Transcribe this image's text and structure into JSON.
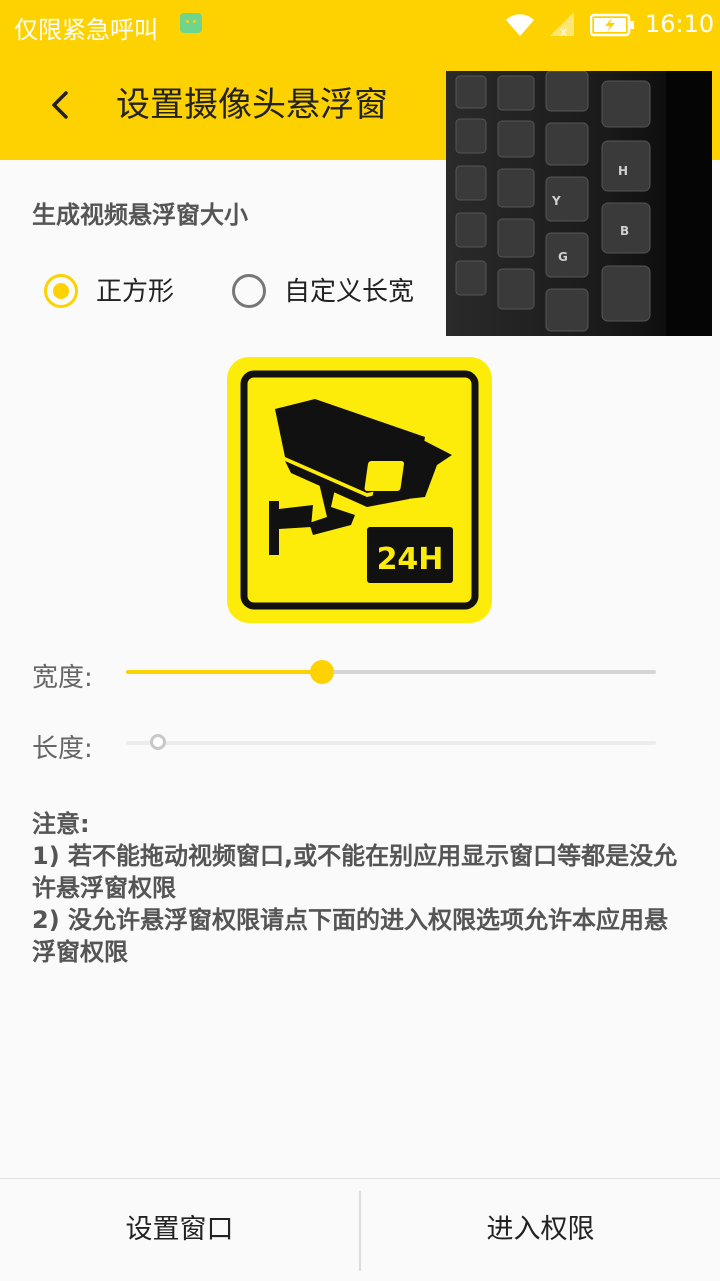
{
  "status_bar": {
    "carrier_text": "仅限紧急呼叫",
    "time": "16:10",
    "icons": [
      "android-icon",
      "wifi-icon",
      "signal-icon",
      "battery-charging-icon"
    ]
  },
  "header": {
    "back_icon": "chevron-left-icon",
    "title": "设置摄像头悬浮窗"
  },
  "preview": {
    "description_icon": "camera-preview"
  },
  "size_section": {
    "label": "生成视频悬浮窗大小",
    "options": [
      {
        "label": "正方形",
        "checked": true
      },
      {
        "label": "自定义长宽",
        "checked": false
      }
    ]
  },
  "logo": {
    "badge_text": "24H",
    "colors": {
      "yellow": "#fdec0a",
      "black": "#111111"
    }
  },
  "sliders": {
    "width": {
      "label": "宽度:",
      "value_fraction": 0.37,
      "enabled": true
    },
    "length": {
      "label": "长度:",
      "value_fraction": 0.06,
      "enabled": false
    }
  },
  "notes": {
    "title": "注意:",
    "line1": "1) 若不能拖动视频窗口,或不能在别应用显示窗口等都是没允许悬浮窗权限",
    "line2": "2) 没允许悬浮窗权限请点下面的进入权限选项允许本应用悬浮窗权限"
  },
  "bottom_bar": {
    "set_window_label": "设置窗口",
    "enter_permission_label": "进入权限"
  },
  "colors": {
    "accent": "#fed200",
    "background": "#fafafa"
  }
}
